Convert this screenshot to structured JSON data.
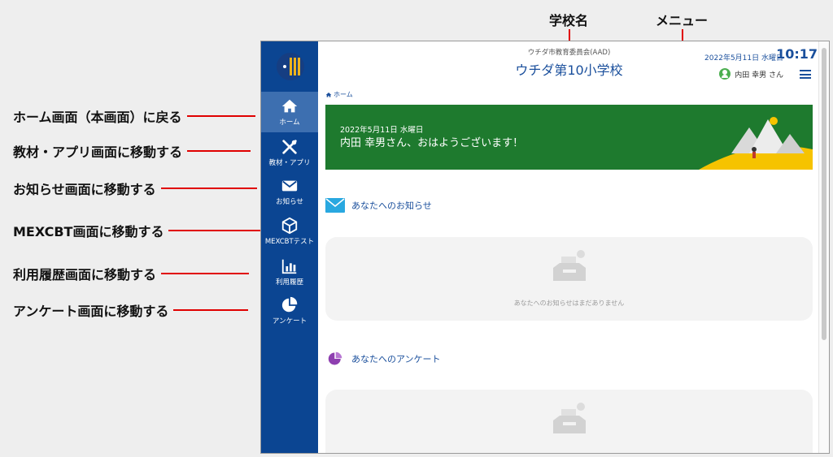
{
  "annotations": {
    "school_name": "学校名",
    "menu": "メニュー",
    "home": "ホーム画面（本画面）に戻る",
    "materials": "教材・アプリ画面に移動する",
    "notices": "お知らせ画面に移動する",
    "mexcbt": "MEXCBT画面に移動する",
    "history": "利用履歴画面に移動する",
    "survey": "アンケート画面に移動する"
  },
  "header": {
    "board": "ウチダ市教育委員会(AAD)",
    "school": "ウチダ第10小学校",
    "date": "2022年5月11日 水曜日",
    "time": "10:17",
    "user_name": "内田 幸男 さん"
  },
  "sidebar": {
    "items": [
      {
        "label": "ホーム",
        "icon": "home-icon"
      },
      {
        "label": "教材・アプリ",
        "icon": "tools-icon"
      },
      {
        "label": "お知らせ",
        "icon": "mail-icon"
      },
      {
        "label": "MEXCBTテスト",
        "icon": "cube-icon"
      },
      {
        "label": "利用履歴",
        "icon": "bar-chart-icon"
      },
      {
        "label": "アンケート",
        "icon": "pie-chart-icon"
      }
    ]
  },
  "breadcrumb": {
    "home": "ホーム"
  },
  "banner": {
    "date": "2022年5月11日 水曜日",
    "greeting": "内田 幸男さん、おはようございます！",
    "bg_color": "#1e7a2e"
  },
  "notices": {
    "title": "あなたへのお知らせ",
    "empty": "あなたへのお知らせはまだありません"
  },
  "surveys": {
    "title": "あなたへのアンケート"
  },
  "colors": {
    "sidebar": "#0b4592",
    "accent": "#1a4f9c",
    "annotation_line": "#e00000"
  }
}
